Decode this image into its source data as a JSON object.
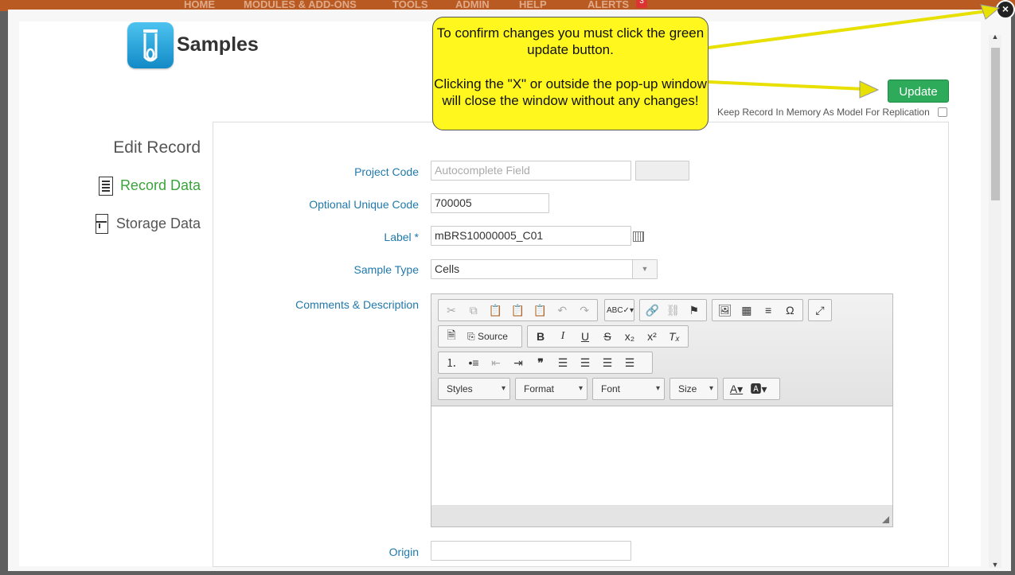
{
  "background": {
    "nav_items": [
      "HOME",
      "MODULES & ADD-ONS",
      "TOOLS",
      "ADMIN",
      "HELP",
      "ALERTS"
    ],
    "alert_count": "3"
  },
  "modal": {
    "close_label": "×",
    "app_title": "Samples",
    "update_label": "Update",
    "keep_record_label": "Keep Record In Memory As Model For Replication",
    "tooltip": {
      "line1": "To confirm changes you must click the green update button.",
      "line2": "Clicking the \"X\" or outside the pop-up window will close the window without any changes!"
    },
    "sidebar": {
      "heading": "Edit Record",
      "items": [
        {
          "label": "Record Data",
          "icon": "list-icon"
        },
        {
          "label": "Storage Data",
          "icon": "fridge-icon"
        }
      ]
    },
    "form": {
      "project_code": {
        "label": "Project Code",
        "placeholder": "Autocomplete Field",
        "value": ""
      },
      "unique_code": {
        "label": "Optional Unique Code",
        "value": "700005"
      },
      "label": {
        "label": "Label *",
        "value": "mBRS10000005_C01"
      },
      "sample_type": {
        "label": "Sample Type",
        "value": "Cells"
      },
      "comments": {
        "label": "Comments & Description"
      },
      "origin": {
        "label": "Origin",
        "value": ""
      }
    },
    "editor": {
      "source_label": "Source",
      "styles_label": "Styles",
      "format_label": "Format",
      "font_label": "Font",
      "size_label": "Size"
    }
  },
  "colors": {
    "accent_green": "#2daa5a",
    "link_blue": "#2179ab",
    "tooltip_yellow": "#fff71d",
    "active_nav_green": "#3ba33b"
  }
}
